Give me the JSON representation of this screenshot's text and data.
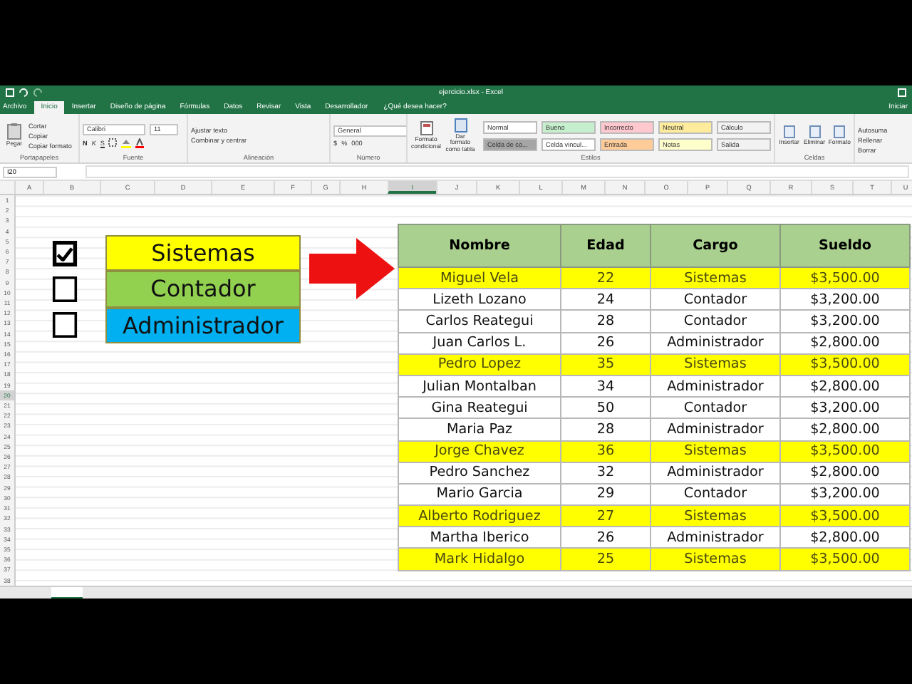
{
  "window": {
    "title": "ejercicio.xlsx - Excel",
    "sign_in": "Iniciar"
  },
  "ribbon_tabs": [
    {
      "label": "Archivo",
      "selected": false
    },
    {
      "label": "Inicio",
      "selected": true
    },
    {
      "label": "Insertar",
      "selected": false
    },
    {
      "label": "Diseño de página",
      "selected": false
    },
    {
      "label": "Fórmulas",
      "selected": false
    },
    {
      "label": "Datos",
      "selected": false
    },
    {
      "label": "Revisar",
      "selected": false
    },
    {
      "label": "Vista",
      "selected": false
    },
    {
      "label": "Desarrollador",
      "selected": false
    }
  ],
  "tell_me": "¿Qué desea hacer?",
  "clipboard": {
    "paste": "Pegar",
    "items": [
      "Cortar",
      "Copiar",
      "Copiar formato"
    ],
    "label": "Portapapeles"
  },
  "font": {
    "family": "Calibri",
    "size": "11",
    "bold": "N",
    "italic": "K",
    "underline": "S",
    "label": "Fuente"
  },
  "alignment": {
    "items": [
      "Ajustar texto",
      "Combinar y centrar"
    ],
    "label": "Alineación"
  },
  "number": {
    "format": "General",
    "currency": "$",
    "percent": "%",
    "thousands": "000",
    "label": "Número"
  },
  "styles": {
    "conditional": "Formato condicional",
    "as_table": "Dar formato como tabla",
    "label": "Estilos",
    "cells": [
      {
        "label": "Normal",
        "color": "#ffffff"
      },
      {
        "label": "Bueno",
        "color": "#c6efce"
      },
      {
        "label": "Incorrecto",
        "color": "#ffc7ce"
      },
      {
        "label": "Neutral",
        "color": "#ffeb9c"
      },
      {
        "label": "Cálculo",
        "color": "#f2f2f2"
      },
      {
        "label": "Celda de co...",
        "color": "#a5a5a5"
      },
      {
        "label": "Celda vincul...",
        "color": "#ffffff"
      },
      {
        "label": "Entrada",
        "color": "#ffcc99"
      },
      {
        "label": "Notas",
        "color": "#ffffcc"
      },
      {
        "label": "Salida",
        "color": "#f2f2f2"
      }
    ]
  },
  "cells_group": {
    "items": [
      "Insertar",
      "Eliminar",
      "Formato"
    ],
    "label": "Celdas"
  },
  "editing": {
    "items": [
      "Autosuma",
      "Rellenar",
      "Borrar"
    ]
  },
  "name_box": "I20",
  "columns": [
    {
      "label": "A",
      "selected": false
    },
    {
      "label": "B",
      "selected": false
    },
    {
      "label": "C",
      "selected": false
    },
    {
      "label": "D",
      "selected": false
    },
    {
      "label": "E",
      "selected": false
    },
    {
      "label": "F",
      "selected": false
    },
    {
      "label": "G",
      "selected": false
    },
    {
      "label": "H",
      "selected": false
    },
    {
      "label": "I",
      "selected": true
    },
    {
      "label": "J",
      "selected": false
    },
    {
      "label": "K",
      "selected": false
    },
    {
      "label": "L",
      "selected": false
    },
    {
      "label": "M",
      "selected": false
    },
    {
      "label": "N",
      "selected": false
    },
    {
      "label": "O",
      "selected": false
    },
    {
      "label": "P",
      "selected": false
    },
    {
      "label": "Q",
      "selected": false
    },
    {
      "label": "R",
      "selected": false
    },
    {
      "label": "S",
      "selected": false
    },
    {
      "label": "T",
      "selected": false
    },
    {
      "label": "U",
      "selected": false
    }
  ],
  "rows": [
    {
      "label": "1",
      "selected": false
    },
    {
      "label": "2",
      "selected": false
    },
    {
      "label": "3",
      "selected": false
    },
    {
      "label": "4",
      "selected": false
    },
    {
      "label": "5",
      "selected": false
    },
    {
      "label": "6",
      "selected": false
    },
    {
      "label": "7",
      "selected": false
    },
    {
      "label": "8",
      "selected": false
    },
    {
      "label": "9",
      "selected": false
    },
    {
      "label": "10",
      "selected": false
    },
    {
      "label": "11",
      "selected": false
    },
    {
      "label": "12",
      "selected": false
    },
    {
      "label": "13",
      "selected": false
    },
    {
      "label": "14",
      "selected": false
    },
    {
      "label": "15",
      "selected": false
    },
    {
      "label": "16",
      "selected": false
    },
    {
      "label": "17",
      "selected": false
    },
    {
      "label": "18",
      "selected": false
    },
    {
      "label": "19",
      "selected": false
    },
    {
      "label": "20",
      "selected": true
    },
    {
      "label": "21",
      "selected": false
    },
    {
      "label": "22",
      "selected": false
    },
    {
      "label": "23",
      "selected": false
    },
    {
      "label": "24",
      "selected": false
    },
    {
      "label": "25",
      "selected": false
    },
    {
      "label": "26",
      "selected": false
    },
    {
      "label": "27",
      "selected": false
    },
    {
      "label": "28",
      "selected": false
    },
    {
      "label": "29",
      "selected": false
    },
    {
      "label": "30",
      "selected": false
    },
    {
      "label": "31",
      "selected": false
    },
    {
      "label": "32",
      "selected": false
    },
    {
      "label": "33",
      "selected": false
    },
    {
      "label": "34",
      "selected": false
    },
    {
      "label": "35",
      "selected": false
    },
    {
      "label": "36",
      "selected": false
    },
    {
      "label": "37",
      "selected": false
    },
    {
      "label": "38",
      "selected": false
    }
  ],
  "options": [
    {
      "label": "Sistemas",
      "checked": true,
      "color": "#ffff00"
    },
    {
      "label": "Contador",
      "checked": false,
      "color": "#92d050"
    },
    {
      "label": "Administrador",
      "checked": false,
      "color": "#00b0f0"
    }
  ],
  "table": {
    "columns": [
      "Nombre",
      "Edad",
      "Cargo",
      "Sueldo"
    ],
    "rows": [
      {
        "cells": [
          "Miguel Vela",
          "22",
          "Sistemas",
          "$3,500.00"
        ],
        "highlighted": true
      },
      {
        "cells": [
          "Lizeth Lozano",
          "24",
          "Contador",
          "$3,200.00"
        ],
        "highlighted": false
      },
      {
        "cells": [
          "Carlos Reategui",
          "28",
          "Contador",
          "$3,200.00"
        ],
        "highlighted": false
      },
      {
        "cells": [
          "Juan Carlos L.",
          "26",
          "Administrador",
          "$2,800.00"
        ],
        "highlighted": false
      },
      {
        "cells": [
          "Pedro Lopez",
          "35",
          "Sistemas",
          "$3,500.00"
        ],
        "highlighted": true
      },
      {
        "cells": [
          "Julian Montalban",
          "34",
          "Administrador",
          "$2,800.00"
        ],
        "highlighted": false
      },
      {
        "cells": [
          "Gina Reategui",
          "50",
          "Contador",
          "$3,200.00"
        ],
        "highlighted": false
      },
      {
        "cells": [
          "Maria Paz",
          "28",
          "Administrador",
          "$2,800.00"
        ],
        "highlighted": false
      },
      {
        "cells": [
          "Jorge Chavez",
          "36",
          "Sistemas",
          "$3,500.00"
        ],
        "highlighted": true
      },
      {
        "cells": [
          "Pedro Sanchez",
          "32",
          "Administrador",
          "$2,800.00"
        ],
        "highlighted": false
      },
      {
        "cells": [
          "Mario Garcia",
          "29",
          "Contador",
          "$3,200.00"
        ],
        "highlighted": false
      },
      {
        "cells": [
          "Alberto Rodriguez",
          "27",
          "Sistemas",
          "$3,500.00"
        ],
        "highlighted": true
      },
      {
        "cells": [
          "Martha Iberico",
          "26",
          "Administrador",
          "$2,800.00"
        ],
        "highlighted": false
      },
      {
        "cells": [
          "Mark Hidalgo",
          "25",
          "Sistemas",
          "$3,500.00"
        ],
        "highlighted": true
      }
    ]
  }
}
